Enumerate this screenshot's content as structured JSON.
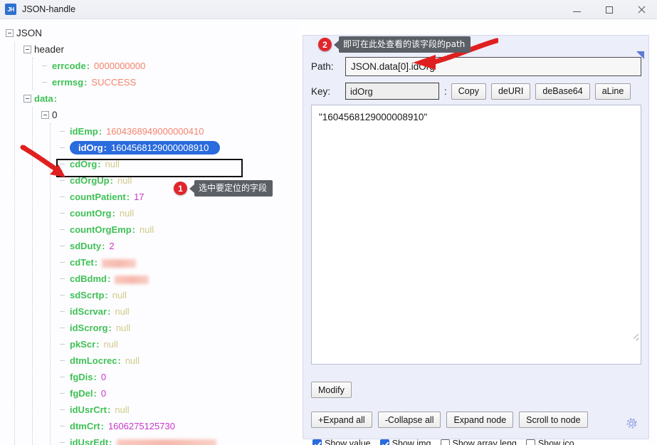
{
  "window": {
    "title": "JSON-handle",
    "icon_label": "JH",
    "minimize": "minimize-button",
    "maximize": "maximize-button",
    "close": "close-button"
  },
  "tree": {
    "root_label": "JSON",
    "header_label": "header",
    "data_label": "data",
    "index_label": "0",
    "colon": ":",
    "header_children": [
      {
        "key": "errcode",
        "value": "0000000000",
        "type": "string"
      },
      {
        "key": "errmsg",
        "value": "SUCCESS",
        "type": "string"
      }
    ],
    "data_children": [
      {
        "key": "idEmp",
        "value": "1604368949000000410",
        "type": "string"
      },
      {
        "key": "idOrg",
        "value": "1604568129000008910",
        "type": "string",
        "selected": true
      },
      {
        "key": "cdOrg",
        "value": "null",
        "type": "null"
      },
      {
        "key": "cdOrgUp",
        "value": "null",
        "type": "null"
      },
      {
        "key": "countPatient",
        "value": "17",
        "type": "number"
      },
      {
        "key": "countOrg",
        "value": "null",
        "type": "null"
      },
      {
        "key": "countOrgEmp",
        "value": "null",
        "type": "null"
      },
      {
        "key": "sdDuty",
        "value": "2",
        "type": "number"
      },
      {
        "key": "cdTet",
        "value": "",
        "type": "redacted",
        "redact_width": 48
      },
      {
        "key": "cdBdmd",
        "value": "",
        "type": "redacted",
        "redact_width": 48
      },
      {
        "key": "sdScrtp",
        "value": "null",
        "type": "null"
      },
      {
        "key": "idScrvar",
        "value": "null",
        "type": "null"
      },
      {
        "key": "idScrorg",
        "value": "null",
        "type": "null"
      },
      {
        "key": "pkScr",
        "value": "null",
        "type": "null"
      },
      {
        "key": "dtmLocrec",
        "value": "null",
        "type": "null"
      },
      {
        "key": "fgDis",
        "value": "0",
        "type": "number"
      },
      {
        "key": "fgDel",
        "value": "0",
        "type": "number"
      },
      {
        "key": "idUsrCrt",
        "value": "null",
        "type": "null"
      },
      {
        "key": "dtmCrt",
        "value": "1606275125730",
        "type": "number"
      },
      {
        "key": "idUsrEdt",
        "value": "",
        "type": "redacted",
        "redact_width": 140
      }
    ]
  },
  "callouts": [
    {
      "number": "1",
      "text": "选中要定位的字段"
    },
    {
      "number": "2",
      "text": "即可在此处查看的该字段的path"
    }
  ],
  "panel": {
    "path_label": "Path:",
    "path_value": "JSON.data[0].idOrg",
    "key_label": "Key:",
    "key_value": "idOrg",
    "key_colon": ":",
    "buttons": {
      "copy": "Copy",
      "deuri": "deURI",
      "debase64": "deBase64",
      "aline": "aLine",
      "modify": "Modify",
      "expand_all": "+Expand all",
      "collapse_all": "-Collapse all",
      "expand_node": "Expand node",
      "scroll_to_node": "Scroll to node"
    },
    "value_text": "\"1604568129000008910\"",
    "checkboxes": [
      {
        "label": "Show value",
        "checked": true
      },
      {
        "label": "Show img",
        "checked": true
      },
      {
        "label": "Show array leng",
        "checked": false
      },
      {
        "label": "Show ico",
        "checked": false
      }
    ],
    "gear": "gear-icon"
  },
  "colors": {
    "key_green": "#3fc155",
    "string_salmon": "#f4826e",
    "number_magenta": "#c836c8",
    "null_khaki": "#cfc98a",
    "selection_blue": "#2a6bdd",
    "accent_red": "#e0262b",
    "panel_bg": "#eceefa"
  }
}
